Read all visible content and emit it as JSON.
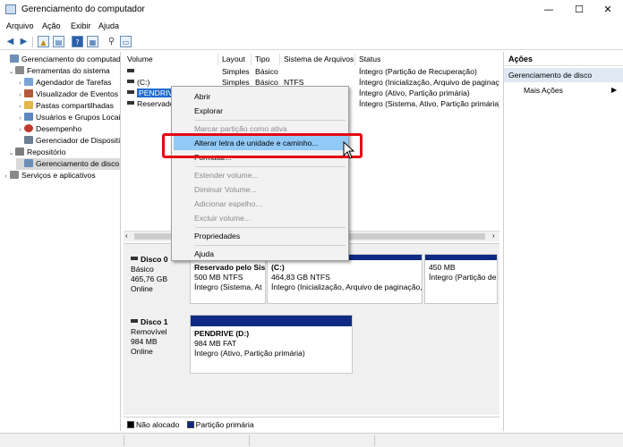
{
  "window": {
    "title": "Gerenciamento do computador"
  },
  "menu": [
    "Arquivo",
    "Ação",
    "Exibir",
    "Ajuda"
  ],
  "tree": {
    "root": "Gerenciamento do computador",
    "tools": "Ferramentas do sistema",
    "tools_children": [
      "Agendador de Tarefas",
      "Visualizador de Eventos",
      "Pastas compartilhadas",
      "Usuários e Grupos Locais",
      "Desempenho",
      "Gerenciador de Dispositivos"
    ],
    "storage": "Repositório",
    "disk_mgmt": "Gerenciamento de disco",
    "services": "Serviços e aplicativos"
  },
  "columns": [
    "Volume",
    "Layout",
    "Tipo",
    "Sistema de Arquivos",
    "Status"
  ],
  "volumes": [
    {
      "name": "",
      "layout": "Simples",
      "type": "Básico",
      "fs": "",
      "status": "Íntegro (Partição de Recuperação)"
    },
    {
      "name": "(C:)",
      "layout": "Simples",
      "type": "Básico",
      "fs": "NTFS",
      "status": "Íntegro (Inicialização, Arquivo de paginação"
    },
    {
      "name": "PENDRIVE",
      "layout": "",
      "type": "",
      "fs": "",
      "status": "Íntegro (Ativo, Partição primária)"
    },
    {
      "name": "Reservado",
      "layout": "",
      "type": "",
      "fs": "",
      "status": "Íntegro (Sistema, Ativo, Partição primária)"
    }
  ],
  "disks": [
    {
      "name": "Disco 0",
      "type": "Básico",
      "size": "465,76 GB",
      "state": "Online",
      "partitions": [
        {
          "title": "Reservado pelo Sis",
          "size": "500 MB NTFS",
          "status": "Íntegro (Sistema, At"
        },
        {
          "title": "(C:)",
          "size": "464,83 GB NTFS",
          "status": "Íntegro (Inicialização, Arquivo de paginação,"
        },
        {
          "title": "",
          "size": "450 MB",
          "status": "Íntegro (Partição de"
        }
      ]
    },
    {
      "name": "Disco 1",
      "type": "Removível",
      "size": "984 MB",
      "state": "Online",
      "partitions": [
        {
          "title": "PENDRIVE  (D:)",
          "size": "984 MB FAT",
          "status": "Íntegro (Ativo, Partição primária)"
        }
      ]
    }
  ],
  "legend": {
    "unallocated": "Não alocado",
    "primary": "Partição primária"
  },
  "actions": {
    "header": "Ações",
    "section": "Gerenciamento de disco",
    "more": "Mais Ações"
  },
  "context_menu": [
    {
      "label": "Abrir",
      "enabled": true
    },
    {
      "label": "Explorar",
      "enabled": true
    },
    {
      "label": "Marcar partição como ativa",
      "enabled": false
    },
    {
      "label": "Alterar letra de unidade e caminho...",
      "enabled": true,
      "highlighted": true
    },
    {
      "label": "Formatar...",
      "enabled": true
    },
    {
      "label": "Estender volume...",
      "enabled": false
    },
    {
      "label": "Diminuir Volume...",
      "enabled": false
    },
    {
      "label": "Adicionar espelho...",
      "enabled": false
    },
    {
      "label": "Excluir volume...",
      "enabled": false
    },
    {
      "label": "Propriedades",
      "enabled": true
    },
    {
      "label": "Ajuda",
      "enabled": true
    }
  ],
  "colors": {
    "selection": "#1f6bd1",
    "partition_header": "#0e2a82",
    "highlight": "#91c9f7",
    "annotation": "#e30613"
  }
}
